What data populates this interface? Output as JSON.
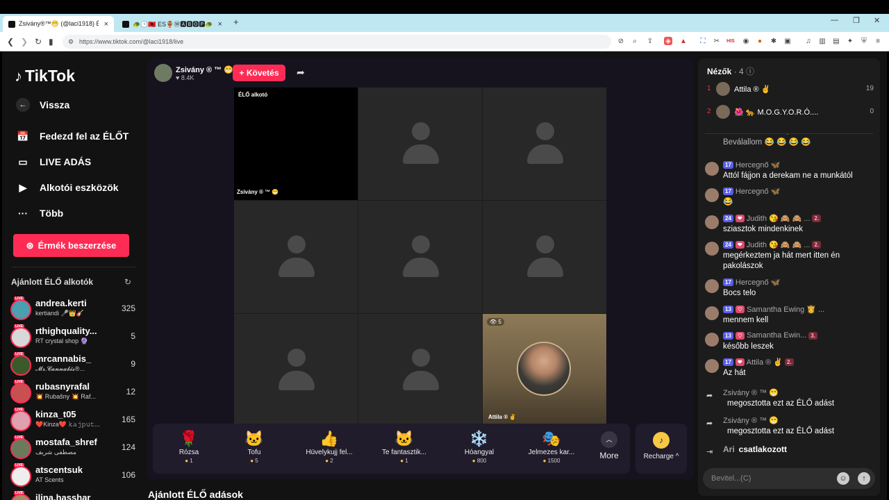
{
  "browser": {
    "tabs": [
      {
        "title": "Zsivány®™😁 (@laci1918) É...",
        "active": true
      },
      {
        "title": "🐢🕒🇦🇱 ES🏺Ⓜ🅰🅱🅾🅿🐢 (@csby0...",
        "active": false
      }
    ],
    "new_tab": "+",
    "url": "https://www.tiktok.com/@laci1918/live",
    "window_controls": [
      "—",
      "❐",
      "✕"
    ]
  },
  "sidebar": {
    "logo": "TikTok",
    "back": "Vissza",
    "nav": [
      {
        "label": "Fedezd fel az ÉLŐT",
        "icon": "calendar-icon"
      },
      {
        "label": "LIVE ADÁS",
        "icon": "camera-icon"
      },
      {
        "label": "Alkotói eszközök",
        "icon": "creator-tools-icon"
      },
      {
        "label": "Több",
        "icon": "more-dots-icon"
      }
    ],
    "coins_button": "Érmék beszerzése",
    "recommended_title": "Ajánlott ÉLŐ alkotók",
    "live_badge": "LIVE",
    "recommended": [
      {
        "name": "andrea.kerti",
        "sub": "kertiandi 🎤👑🎸",
        "count": "325",
        "color": "#4a9fb0"
      },
      {
        "name": "rthighquality...",
        "sub": "RT crystal shop 🔮",
        "count": "5",
        "color": "#d8d8d8"
      },
      {
        "name": "mrcannabis_",
        "sub": "𝓜𝓻.𝓒𝓪𝓷𝓷𝓪𝓫𝓲𝓼®...",
        "count": "9",
        "color": "#3a5a2a"
      },
      {
        "name": "rubasnyrafal",
        "sub": "💥 Rubašny 💥 Raf...",
        "count": "12",
        "color": "#c85050"
      },
      {
        "name": "kinza_t05",
        "sub": "❤️Kinza❤️ 𝚔𝚊𝚓𝚙𝚞𝚝...",
        "count": "165",
        "color": "#e0a0b0"
      },
      {
        "name": "mostafa_shref",
        "sub": "مصطفى شريف",
        "count": "124",
        "color": "#6a7a5a"
      },
      {
        "name": "atscentsuk",
        "sub": "AT Scents",
        "count": "106",
        "color": "#eeeeee"
      },
      {
        "name": "ilina.hasshar",
        "sub": "",
        "count": "",
        "color": "#aa8866"
      }
    ]
  },
  "stream": {
    "host_name": "Zsivány ® ™ 😁",
    "host_likes": "♥ 8.4K",
    "follow_button": "+ Követés",
    "host_tile_label": "ÉLŐ alkotó",
    "host_tile_name": "Zsivány ® ™ 😁",
    "cam_tile_name": "Attila ® ✌",
    "cam_tile_viewers": "👁 5",
    "gifts": [
      {
        "name": "Rózsa",
        "price": "1",
        "icon": "🌹"
      },
      {
        "name": "Tofu",
        "price": "5",
        "icon": "🐱"
      },
      {
        "name": "Hüvelykujj fel...",
        "price": "2",
        "icon": "👍"
      },
      {
        "name": "Te fantasztik...",
        "price": "1",
        "icon": "🐱"
      },
      {
        "name": "Hóangyal",
        "price": "800",
        "icon": "❄️"
      },
      {
        "name": "Jelmezes kar...",
        "price": "1500",
        "icon": "🎭"
      }
    ],
    "more_label": "More",
    "recharge_label": "Recharge ^",
    "below_title": "Ajánlott ÉLŐ adások"
  },
  "chat": {
    "viewers_title": "Nézők",
    "viewers_count": "· 4",
    "top_viewers": [
      {
        "rank": "1",
        "name": "Attila ® ✌",
        "score": "19"
      },
      {
        "rank": "2",
        "name": "🌺 🐆 M.O.G.Y.O.R.Ó....",
        "score": "0"
      }
    ],
    "messages": [
      {
        "user": "",
        "level": "",
        "fan": "",
        "sub": "",
        "text": "Beválallom 😂 😂 😂 😂",
        "y": 0,
        "partial": true
      },
      {
        "user": "Hercegnő 🦋",
        "level": "17",
        "fan": "",
        "sub": "",
        "text": "Attól fájjon a derekam ne a munkától"
      },
      {
        "user": "Hercegnő 🦋",
        "level": "17",
        "fan": "",
        "sub": "",
        "text": "😂"
      },
      {
        "user": "Judith 😘 🙈 🙈 ...",
        "level": "24",
        "fan": "❤",
        "sub": "2.",
        "text": "sziasztok mindenkinek"
      },
      {
        "user": "Judith 😘 🙈 🙈 ...",
        "level": "24",
        "fan": "❤",
        "sub": "2.",
        "text": "megérkeztem ja hát mert itten én pakolászok"
      },
      {
        "user": "Hercegnő 🦋",
        "level": "17",
        "fan": "",
        "sub": "",
        "text": "Bocs telo"
      },
      {
        "user": "Samantha Ewing 👸 ...",
        "level": "13",
        "fan": "♡",
        "sub": "",
        "text": "mennem kell"
      },
      {
        "user": "Samantha Ewin...",
        "level": "13",
        "fan": "♡",
        "sub": "3.",
        "text": "később leszek"
      },
      {
        "user": "Attila ® ✌",
        "level": "17",
        "fan": "❤",
        "sub": "2.",
        "text": "Az hát"
      }
    ],
    "shares": [
      {
        "user": "Zsivány ® ™ 😁",
        "text": "megosztotta ezt az ÉLŐ adást"
      },
      {
        "user": "Zsivány ® ™ 😁",
        "text": "megosztotta ezt az ÉLŐ adást"
      }
    ],
    "join": {
      "user": "Ari",
      "text": "csatlakozott"
    },
    "input_placeholder": "Bevitel...(C)"
  }
}
